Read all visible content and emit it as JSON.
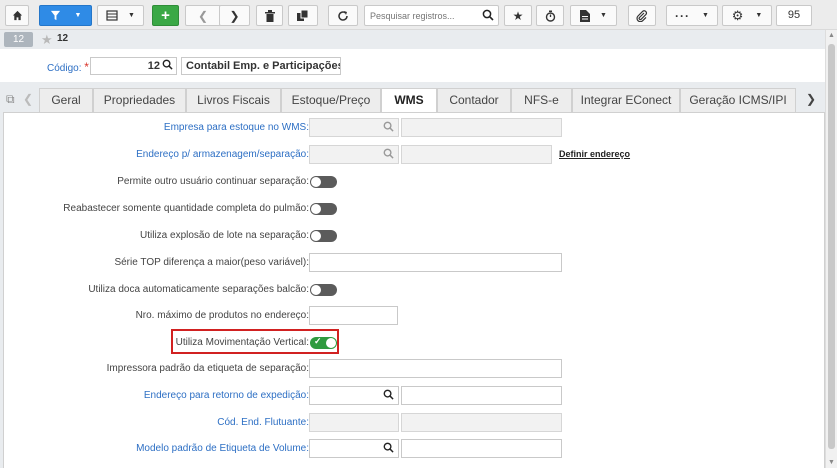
{
  "toolbar": {
    "search_placeholder": "Pesquisar registros...",
    "page_size": "95"
  },
  "record": {
    "badge": "12",
    "label": "12"
  },
  "code": {
    "label": "Código:",
    "value": "12",
    "description": "Contabil Emp. e Participações S/"
  },
  "tabs": [
    "Geral",
    "Propriedades",
    "Livros Fiscais",
    "Estoque/Preço",
    "WMS",
    "Contador",
    "NFS-e",
    "Integrar EConect",
    "Geração ICMS/IPI"
  ],
  "active_tab": "WMS",
  "fields": {
    "empresa_estoque": "Empresa para estoque no WMS:",
    "endereco_armazenagem": "Endereço p/ armazenagem/separação:",
    "definir_endereco": "Definir endereço",
    "permite_outro_usuario": "Permite outro usuário continuar separação:",
    "reabastecer": "Reabastecer somente quantidade completa do pulmão:",
    "explosao_lote": "Utiliza explosão de lote na separação:",
    "serie_top": "Série TOP diferença a maior(peso variável):",
    "doca_balcao": "Utiliza doca automaticamente separações balcão:",
    "nro_maximo": "Nro. máximo de produtos no endereço:",
    "movimentacao_vertical": "Utiliza Movimentação Vertical:",
    "impressora": "Impressora padrão da etiqueta de separação:",
    "endereco_retorno": "Endereço para retorno de expedição:",
    "cod_end_flutuante": "Cód. End. Flutuante:",
    "modelo_etiqueta": "Modelo padrão de Etiqueta de Volume:"
  },
  "toggles": {
    "permite_outro_usuario": false,
    "reabastecer": false,
    "explosao_lote": false,
    "doca_balcao": false,
    "movimentacao_vertical": true
  },
  "colors": {
    "primary_blue": "#2f8be6",
    "add_green": "#3aa845",
    "link_blue": "#2d6fc4",
    "toggle_on": "#2f9a3f",
    "highlight_red": "#d12121"
  }
}
